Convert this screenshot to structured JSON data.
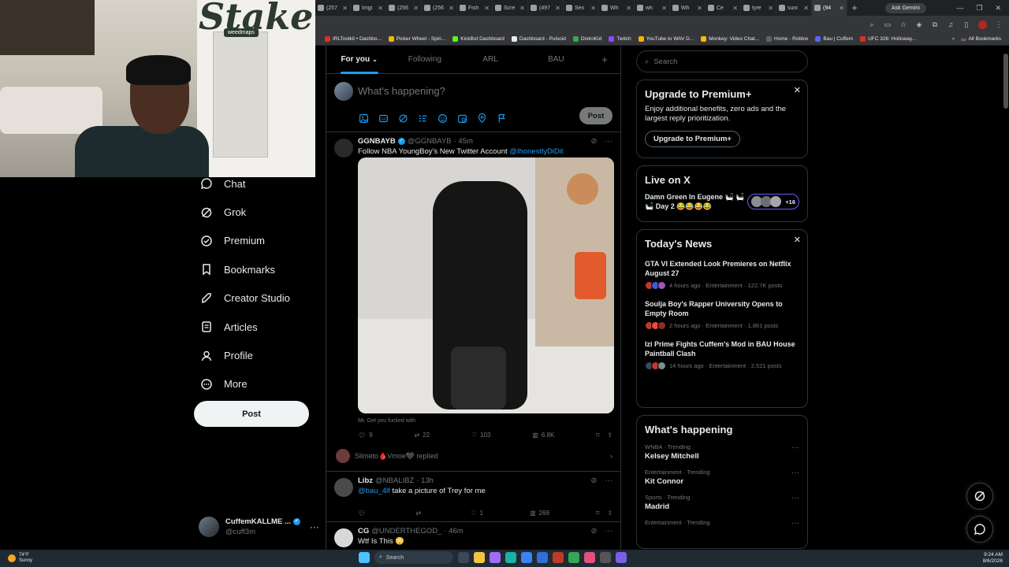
{
  "browser": {
    "tabs": [
      {
        "label": "(257",
        "active": false
      },
      {
        "label": "Imgi",
        "active": false
      },
      {
        "label": "(256",
        "active": false
      },
      {
        "label": "(256",
        "active": false
      },
      {
        "label": "Fish",
        "active": false
      },
      {
        "label": "Scre",
        "active": false
      },
      {
        "label": "(497",
        "active": false
      },
      {
        "label": "Sex",
        "active": false
      },
      {
        "label": "Wh",
        "active": false
      },
      {
        "label": "wh",
        "active": false
      },
      {
        "label": "Wh",
        "active": false
      },
      {
        "label": "Ce",
        "active": false
      },
      {
        "label": "tyre",
        "active": false
      },
      {
        "label": "suni",
        "active": false
      },
      {
        "label": "(94",
        "active": true
      }
    ],
    "new_tab": "+",
    "gemini_label": "Ask Gemini",
    "bookmarks": [
      {
        "label": "IRLToolkit • Dashbo...",
        "color": "#d93025"
      },
      {
        "label": "Picker Wheel - Spin...",
        "color": "#f4b400"
      },
      {
        "label": "KickBot Dashboard",
        "color": "#53fc18"
      },
      {
        "label": "Dashboard - Pulsoid",
        "color": "#e8eaed"
      },
      {
        "label": "DistroKid",
        "color": "#34a853"
      },
      {
        "label": "Twitch",
        "color": "#9146ff"
      },
      {
        "label": "YouTube to WAV D...",
        "color": "#f4b400"
      },
      {
        "label": "Monkey: Video Chat...",
        "color": "#fbbc04"
      },
      {
        "label": "Home - Roblox",
        "color": "#5f6368"
      },
      {
        "label": "Bau | Cuffem",
        "color": "#5865f2"
      },
      {
        "label": "UFC 326: Holloway...",
        "color": "#d93025"
      }
    ],
    "bookmarks_more": "»",
    "all_bookmarks": "All Bookmarks"
  },
  "webcam": {
    "logo": "Stake",
    "sign": "weedmaps"
  },
  "nav": {
    "items": [
      {
        "label": "Chat",
        "icon": "chat-icon"
      },
      {
        "label": "Grok",
        "icon": "grok-icon"
      },
      {
        "label": "Premium",
        "icon": "premium-icon"
      },
      {
        "label": "Bookmarks",
        "icon": "bookmark-icon"
      },
      {
        "label": "Creator Studio",
        "icon": "rocket-icon"
      },
      {
        "label": "Articles",
        "icon": "articles-icon"
      },
      {
        "label": "Profile",
        "icon": "profile-icon"
      },
      {
        "label": "More",
        "icon": "more-icon"
      }
    ],
    "post_label": "Post"
  },
  "account": {
    "display_name": "CuffemKALLME ...",
    "handle": "@cuff3m"
  },
  "feed": {
    "tabs": [
      "For you",
      "Following",
      "ARL",
      "BAU"
    ],
    "add_tab": "+"
  },
  "composer": {
    "placeholder": "What's happening?",
    "post_label": "Post"
  },
  "tweets": [
    {
      "display_name": "GGNBAYB",
      "handle": "@GGNBAYB",
      "time": "· 45m",
      "text": "Follow NBA YoungBoy's New Twitter Account ",
      "mention": "@IhonestlyDiDit",
      "caption": "Mr. Get you fucked with",
      "replies": "9",
      "reposts": "22",
      "likes": "103",
      "views": "6.8K",
      "replied_text": "Slimeto🩸Vmoe🖤 replied"
    },
    {
      "display_name": "Libz",
      "handle": "@NBALIBZ",
      "time": "· 13h",
      "mention": "@bau_4lf",
      "text": " take a picture of Trey for me",
      "replies": "",
      "reposts": "",
      "likes": "1",
      "views": "269"
    },
    {
      "display_name": "CG",
      "handle": "@UNDERTHEGOD_",
      "time": "· 46m",
      "text": "Wtf Is This 😳"
    }
  ],
  "search": {
    "placeholder": "Search"
  },
  "premium": {
    "title": "Upgrade to Premium+",
    "body": "Enjoy additional benefits, zero ads and the largest reply prioritization.",
    "button": "Upgrade to Premium+"
  },
  "live": {
    "title": "Live on X",
    "stream_title": "Damn Green In Eugene 🛀 🛀🛀 Day 2 😂😂😂😂",
    "count": "+16"
  },
  "news": {
    "title": "Today's News",
    "items": [
      {
        "headline": "GTA VI Extended Look Premieres on Netflix August 27",
        "meta": "4 hours ago · Entertainment · 122.7K posts"
      },
      {
        "headline": "Soulja Boy's Rapper University Opens to Empty Room",
        "meta": "2 hours ago · Entertainment · 1,861 posts"
      },
      {
        "headline": "Izi Prime Fights Cuffem's Mod in BAU House Paintball Clash",
        "meta": "14 hours ago · Entertainment · 2,521 posts"
      }
    ]
  },
  "happening": {
    "title": "What's happening",
    "trends": [
      {
        "context": "WNBA · Trending",
        "name": "Kelsey Mitchell"
      },
      {
        "context": "Entertainment · Trending",
        "name": "Kit Connor"
      },
      {
        "context": "Sports · Trending",
        "name": "Madrid"
      },
      {
        "context": "Entertainment · Trending",
        "name": ""
      }
    ]
  },
  "taskbar": {
    "temp": "74°F",
    "condition": "Sunny",
    "search": "Search",
    "time": "9:24 AM",
    "date": "8/6/2026"
  },
  "colors": {
    "accent": "#1d9bf0",
    "background": "#000000",
    "border": "#2f3336"
  }
}
